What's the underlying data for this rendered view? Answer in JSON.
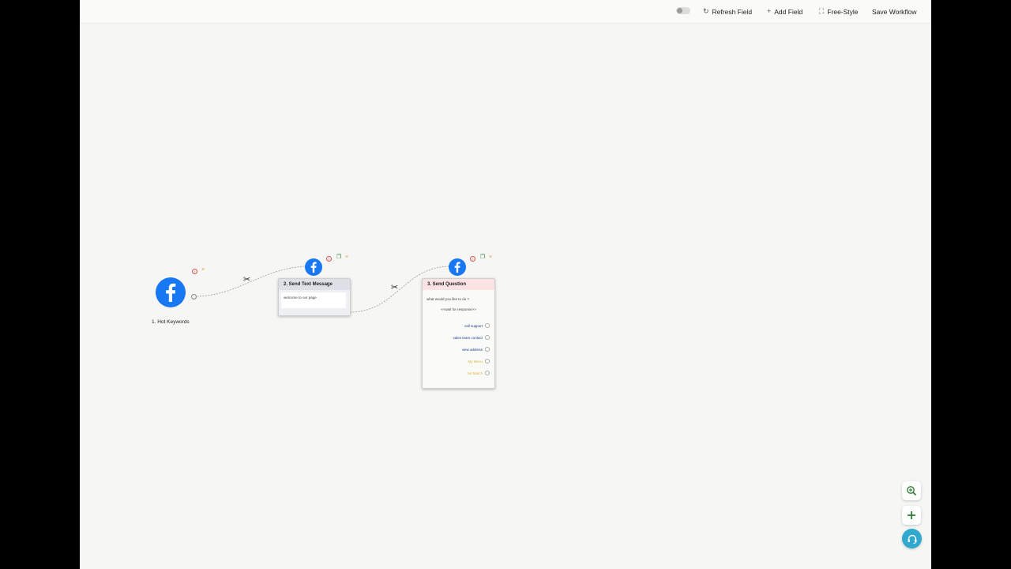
{
  "toolbar": {
    "refresh_label": "Refresh Field",
    "refresh_icon": "↻",
    "add_label": "Add Field",
    "add_icon": "+",
    "freestyle_label": "Free-Style",
    "freestyle_icon": "⛶",
    "save_label": "Save Workflow"
  },
  "nodes": {
    "hot_keywords": {
      "label": "1. Hot Keywords"
    },
    "send_text": {
      "title": "2. Send Text Message",
      "message": "welcome to our page"
    },
    "send_question": {
      "title": "3. Send Question",
      "question": "what would you like to do ?",
      "wait_text": "<<wait for response>>",
      "replies": [
        {
          "label": "call support",
          "color": "#1c3a8c"
        },
        {
          "label": "sales team contact",
          "color": "#1c3a8c"
        },
        {
          "label": "view address",
          "color": "#1c3a8c"
        },
        {
          "label": "My Menu",
          "color": "#d9b84a"
        },
        {
          "label": "No Match",
          "color": "#d9b84a"
        }
      ]
    }
  },
  "icons": {
    "info": "!",
    "copy": "❐",
    "close": "×",
    "cut": "✂"
  },
  "colors": {
    "facebook": "#1877f2",
    "text_card_header": "#dde1e7",
    "question_card_header": "#fbe3e3",
    "fab_support": "#31a9cf",
    "fab_icon": "#2e7d32"
  }
}
